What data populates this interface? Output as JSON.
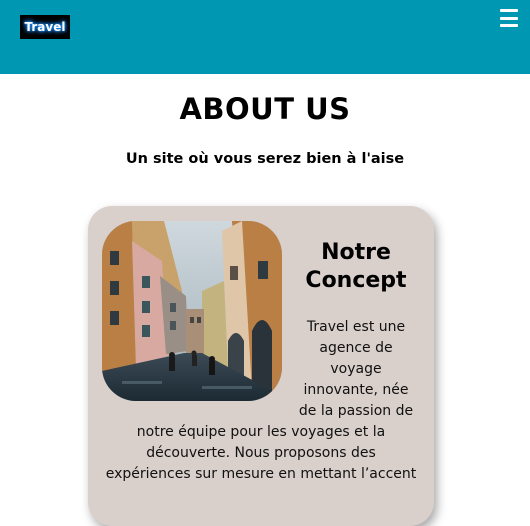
{
  "header": {
    "logo_text": "Travel",
    "menu_icon": "hamburger-menu-icon",
    "bg_color": "#0097b2"
  },
  "about": {
    "title": "ABOUT US",
    "subtitle": "Un site où vous serez bien à l'aise"
  },
  "card": {
    "title_line1": "Notre",
    "title_line2": "Concept",
    "text_side": [
      "Travel est une",
      "agence de",
      "voyage",
      "innovante, née",
      "de la passion de"
    ],
    "text_full": [
      "notre équipe pour les voyages et la",
      "découverte. Nous proposons des",
      "expériences sur mesure en mettant l’accent"
    ],
    "bg_color": "#d9cfcb",
    "image": "city-street-photo"
  }
}
